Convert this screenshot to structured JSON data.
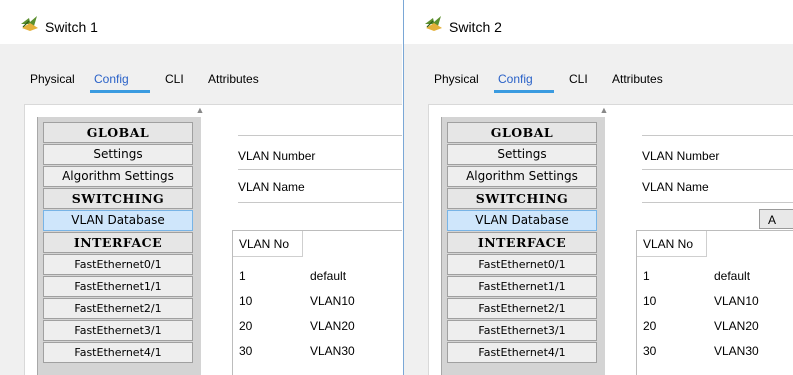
{
  "windows": [
    {
      "title": "Switch 1",
      "tabs": [
        "Physical",
        "Config",
        "CLI",
        "Attributes"
      ],
      "active_tab": "Config",
      "sidebar": [
        "GLOBAL",
        "Settings",
        "Algorithm Settings",
        "SWITCHING",
        "VLAN Database",
        "INTERFACE",
        "FastEthernet0/1",
        "FastEthernet1/1",
        "FastEthernet2/1",
        "FastEthernet3/1",
        "FastEthernet4/1"
      ],
      "selected_item": "VLAN Database",
      "fields": {
        "vlan_number_label": "VLAN Number",
        "vlan_name_label": "VLAN Name"
      },
      "table": {
        "header": "VLAN No",
        "rows": [
          {
            "no": "1",
            "name": "default"
          },
          {
            "no": "10",
            "name": "VLAN10"
          },
          {
            "no": "20",
            "name": "VLAN20"
          },
          {
            "no": "30",
            "name": "VLAN30"
          }
        ]
      }
    },
    {
      "title": "Switch 2",
      "tabs": [
        "Physical",
        "Config",
        "CLI",
        "Attributes"
      ],
      "active_tab": "Config",
      "sidebar": [
        "GLOBAL",
        "Settings",
        "Algorithm Settings",
        "SWITCHING",
        "VLAN Database",
        "INTERFACE",
        "FastEthernet0/1",
        "FastEthernet1/1",
        "FastEthernet2/1",
        "FastEthernet3/1",
        "FastEthernet4/1"
      ],
      "selected_item": "VLAN Database",
      "fields": {
        "vlan_number_label": "VLAN Number",
        "vlan_name_label": "VLAN Name"
      },
      "add_button_label": "A",
      "table": {
        "header": "VLAN No",
        "rows": [
          {
            "no": "1",
            "name": "default"
          },
          {
            "no": "10",
            "name": "VLAN10"
          },
          {
            "no": "20",
            "name": "VLAN20"
          },
          {
            "no": "30",
            "name": "VLAN30"
          }
        ]
      }
    }
  ],
  "icon": "packet-tracer-switch-icon",
  "colors": {
    "active_tab": "#2a62c8",
    "tab_underline": "#3a9be0",
    "selected_item_bg": "#cfe6fb"
  }
}
